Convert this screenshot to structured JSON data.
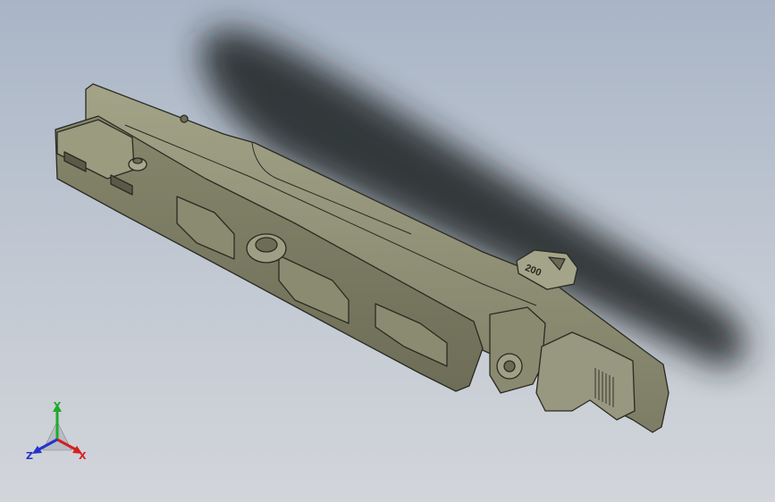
{
  "viewport": {
    "background_top": "#a9b5c6",
    "background_bottom": "#d2d5da",
    "model_color": "#8f8f76",
    "edge_color": "#2a2a22"
  },
  "part": {
    "tag_label": "200"
  },
  "triad": {
    "x_label": "X",
    "y_label": "Y",
    "z_label": "Z",
    "x_color": "#d42020",
    "y_color": "#1faa2a",
    "z_color": "#2233cc"
  }
}
